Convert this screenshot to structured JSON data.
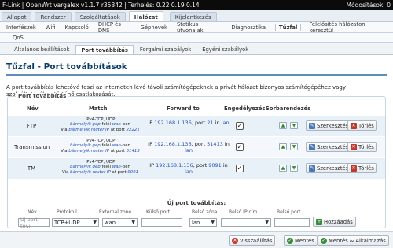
{
  "topbar": {
    "left": "F-Link | OpenWrt vargalex v1.1.7 r35342 | Terhelés: 0.22 0.19 0.14",
    "right": "Módosítások: 0"
  },
  "mainnav": [
    "Állapot",
    "Rendszer",
    "Szolgáltatások",
    "Hálózat",
    "Kijelentkezés"
  ],
  "subnav": [
    "Interfészek",
    "Wifi",
    "Kapcsoló",
    "DHCP és DNS",
    "Gépnevek",
    "Statikus útvonalak",
    "Diagnosztika",
    "Tűzfal",
    "Felelősítés hálózaton keresztül"
  ],
  "qos": "QoS",
  "tabs": [
    "Általános beállítások",
    "Port továbbítás",
    "Forgalmi szabályok",
    "Egyéni szabályok"
  ],
  "page": {
    "title": "Tűzfal - Port továbbítások",
    "desc": "A port továbbítás lehetővé teszi az interneten lévő távoli számítógépeknek a privát hálózat bizonyos számítógépéhez vagy szolgáltatásához történő csatlakozását."
  },
  "section": {
    "legend": "Port továbbítás",
    "headers": {
      "name": "Név",
      "match": "Match",
      "forward": "Forward to",
      "enabled": "Engedélyezés",
      "sort": "Sorbarendezés"
    },
    "edit": "Szerkesztés",
    "delete": "Törlés",
    "rows": [
      {
        "name": "FTP",
        "m1": "IPv4-TCP, UDP",
        "m2a": "bármelyik gép",
        "m2b": " feléi ",
        "m2c": "wan",
        "m2d": "-ben",
        "m3a": "Via ",
        "m3b": "bármelyik router IP",
        "m3c": " at port ",
        "m3d": "22221",
        "f1a": "IP ",
        "f1b": "192.168.1.136",
        "f1c": ", port ",
        "f1d": "21",
        "f1e": " in ",
        "f1f": "lan",
        "f2": ""
      },
      {
        "name": "Transmission",
        "m1": "IPv4-TCP, UDP",
        "m2a": "bármelyik gép",
        "m2b": " feléi ",
        "m2c": "wan",
        "m2d": "-ben",
        "m3a": "Via ",
        "m3b": "bármelyik router IP",
        "m3c": " at port ",
        "m3d": "51413",
        "f1a": "IP ",
        "f1b": "192.168.1.136",
        "f1c": ", port ",
        "f1d": "51413",
        "f1e": " in",
        "f1f": "",
        "f2": "lan"
      },
      {
        "name": "TM",
        "m1": "IPv4-TCP, UDP",
        "m2a": "bármelyik gép",
        "m2b": " feléi ",
        "m2c": "wan",
        "m2d": "-ben",
        "m3a": "Via ",
        "m3b": "bármelyik router IP",
        "m3c": " at port ",
        "m3d": "9091",
        "f1a": "IP ",
        "f1b": "192.168.1.136",
        "f1c": ", port ",
        "f1d": "9091",
        "f1e": " in ",
        "f1f": "lan",
        "f2": ""
      }
    ]
  },
  "newport": {
    "title": "Új port továbbítás:",
    "labels": {
      "name": "Név",
      "protocol": "Protokoll",
      "zone": "External zone",
      "ext": "Külső port",
      "int_zone": "Belső zóna",
      "ip": "Belső IP cím",
      "int_port": "Belső port"
    },
    "name_placeholder": "Új port tovi",
    "protocol": "TCP+UDP",
    "zone": "wan",
    "int_zone": "lan",
    "add": "Hozzáadás"
  },
  "footer": {
    "revert": "Visszaállítás",
    "save": "Mentés",
    "save_apply": "Mentés & Alkalmazás"
  }
}
